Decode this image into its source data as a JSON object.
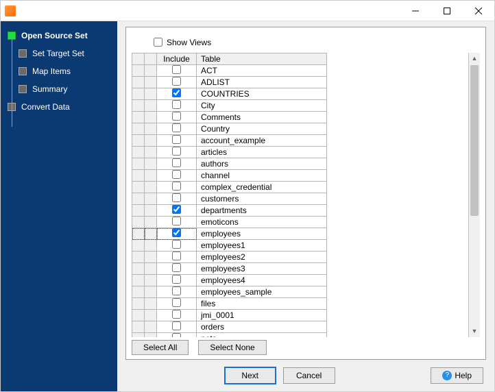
{
  "window": {
    "title": ""
  },
  "sidebar": {
    "steps": [
      {
        "label": "Open Source Set",
        "active": true,
        "indent": false
      },
      {
        "label": "Set Target Set",
        "active": false,
        "indent": true
      },
      {
        "label": "Map Items",
        "active": false,
        "indent": true
      },
      {
        "label": "Summary",
        "active": false,
        "indent": true
      },
      {
        "label": "Convert Data",
        "active": false,
        "indent": false
      }
    ]
  },
  "main": {
    "show_views_label": "Show Views",
    "show_views_checked": false,
    "columns": {
      "include": "Include",
      "table": "Table"
    },
    "rows": [
      {
        "include": false,
        "table": "ACT"
      },
      {
        "include": false,
        "table": "ADLIST"
      },
      {
        "include": true,
        "table": "COUNTRIES"
      },
      {
        "include": false,
        "table": "City"
      },
      {
        "include": false,
        "table": "Comments"
      },
      {
        "include": false,
        "table": "Country"
      },
      {
        "include": false,
        "table": "account_example"
      },
      {
        "include": false,
        "table": "articles"
      },
      {
        "include": false,
        "table": "authors"
      },
      {
        "include": false,
        "table": "channel"
      },
      {
        "include": false,
        "table": "complex_credential"
      },
      {
        "include": false,
        "table": "customers"
      },
      {
        "include": true,
        "table": "departments"
      },
      {
        "include": false,
        "table": "emoticons"
      },
      {
        "include": true,
        "table": "employees",
        "focus": true
      },
      {
        "include": false,
        "table": "employees1"
      },
      {
        "include": false,
        "table": "employees2"
      },
      {
        "include": false,
        "table": "employees3"
      },
      {
        "include": false,
        "table": "employees4"
      },
      {
        "include": false,
        "table": "employees_sample"
      },
      {
        "include": false,
        "table": "files"
      },
      {
        "include": false,
        "table": "jmi_0001"
      },
      {
        "include": false,
        "table": "orders"
      },
      {
        "include": false,
        "table": "pets"
      }
    ],
    "buttons": {
      "select_all": "Select All",
      "select_none": "Select None",
      "next": "Next",
      "cancel": "Cancel",
      "help": "Help"
    }
  }
}
